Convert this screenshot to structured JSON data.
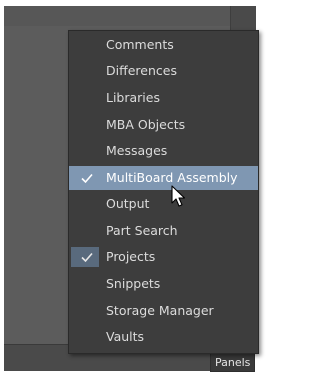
{
  "menu": {
    "items": [
      {
        "label": "Comments",
        "checked": false,
        "highlighted": false
      },
      {
        "label": "Differences",
        "checked": false,
        "highlighted": false
      },
      {
        "label": "Libraries",
        "checked": false,
        "highlighted": false
      },
      {
        "label": "MBA Objects",
        "checked": false,
        "highlighted": false
      },
      {
        "label": "Messages",
        "checked": false,
        "highlighted": false
      },
      {
        "label": "MultiBoard Assembly",
        "checked": true,
        "highlighted": true
      },
      {
        "label": "Output",
        "checked": false,
        "highlighted": false
      },
      {
        "label": "Part Search",
        "checked": false,
        "highlighted": false
      },
      {
        "label": "Projects",
        "checked": true,
        "highlighted": false
      },
      {
        "label": "Snippets",
        "checked": false,
        "highlighted": false
      },
      {
        "label": "Storage Manager",
        "checked": false,
        "highlighted": false
      },
      {
        "label": "Vaults",
        "checked": false,
        "highlighted": false
      }
    ]
  },
  "statusbar": {
    "panels_label": "Panels"
  },
  "icons": {
    "check": "check-icon",
    "cursor": "mouse-pointer-icon"
  },
  "colors": {
    "menu_bg": "#3d3d3d",
    "highlight": "#7f97b2",
    "checked_bg": "#596a7d",
    "text": "#dcdcdc"
  }
}
